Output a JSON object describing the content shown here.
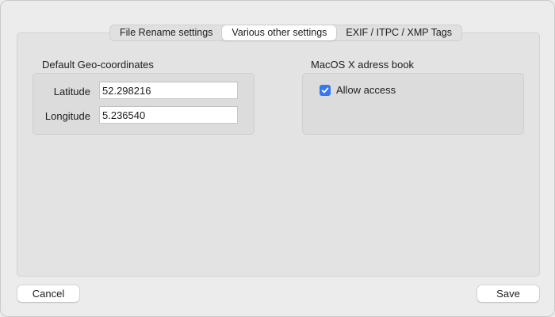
{
  "tabs": [
    {
      "label": "File Rename settings",
      "active": false
    },
    {
      "label": "Various other settings",
      "active": true
    },
    {
      "label": "EXIF / ITPC / XMP Tags",
      "active": false
    }
  ],
  "geo": {
    "title": "Default Geo-coordinates",
    "latitude_label": "Latitude",
    "latitude_value": "52.298216",
    "longitude_label": "Longitude",
    "longitude_value": "5.236540"
  },
  "addressbook": {
    "title": "MacOS X adress book",
    "allow_access_label": "Allow access",
    "allow_access_checked": true
  },
  "buttons": {
    "cancel": "Cancel",
    "save": "Save"
  },
  "colors": {
    "accent": "#3478f6"
  }
}
